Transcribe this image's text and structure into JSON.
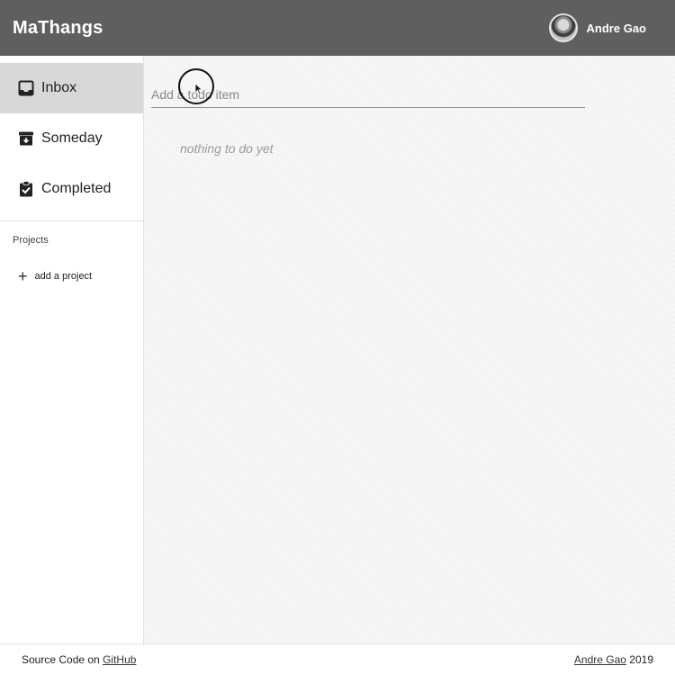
{
  "header": {
    "app_title": "MaThangs",
    "user_name": "Andre Gao"
  },
  "sidebar": {
    "items": [
      {
        "label": "Inbox",
        "icon": "inbox-icon",
        "active": true
      },
      {
        "label": "Someday",
        "icon": "archive-icon",
        "active": false
      },
      {
        "label": "Completed",
        "icon": "clipboard-check-icon",
        "active": false
      }
    ],
    "projects_label": "Projects",
    "add_project_label": "add a project"
  },
  "main": {
    "input_placeholder": "Add a todo item",
    "empty_message": "nothing to do yet"
  },
  "footer": {
    "source_prefix": "Source Code on ",
    "source_link": "GitHub",
    "author_link": "Andre Gao",
    "year": " 2019"
  },
  "colors": {
    "header_bg": "#5f5f5f",
    "active_item_bg": "#d8d8d8"
  }
}
